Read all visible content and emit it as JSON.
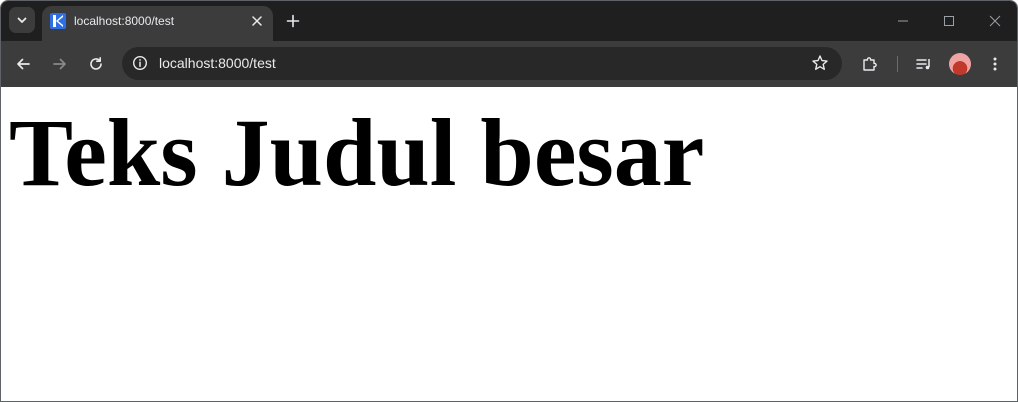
{
  "browser": {
    "tab": {
      "title": "localhost:8000/test",
      "favicon": "kotlin-logo-icon"
    },
    "address_bar": {
      "url": "localhost:8000/test"
    },
    "icons": {
      "tab_search": "chevron-down-icon",
      "tab_close": "close-icon",
      "new_tab": "plus-icon",
      "minimize": "minimize-icon",
      "maximize": "maximize-icon",
      "close_window": "close-icon",
      "back": "arrow-left-icon",
      "forward": "arrow-right-icon",
      "reload": "reload-icon",
      "site_info": "info-icon",
      "bookmark": "star-icon",
      "extensions": "puzzle-icon",
      "media": "media-queue-icon",
      "menu": "kebab-menu-icon"
    },
    "colors": {
      "tabstrip": "#1f1f1f",
      "toolbar": "#3c3c3c",
      "omnibox": "#282828",
      "favicon": "#2f6fe4"
    }
  },
  "page": {
    "heading": "Teks Judul besar"
  }
}
